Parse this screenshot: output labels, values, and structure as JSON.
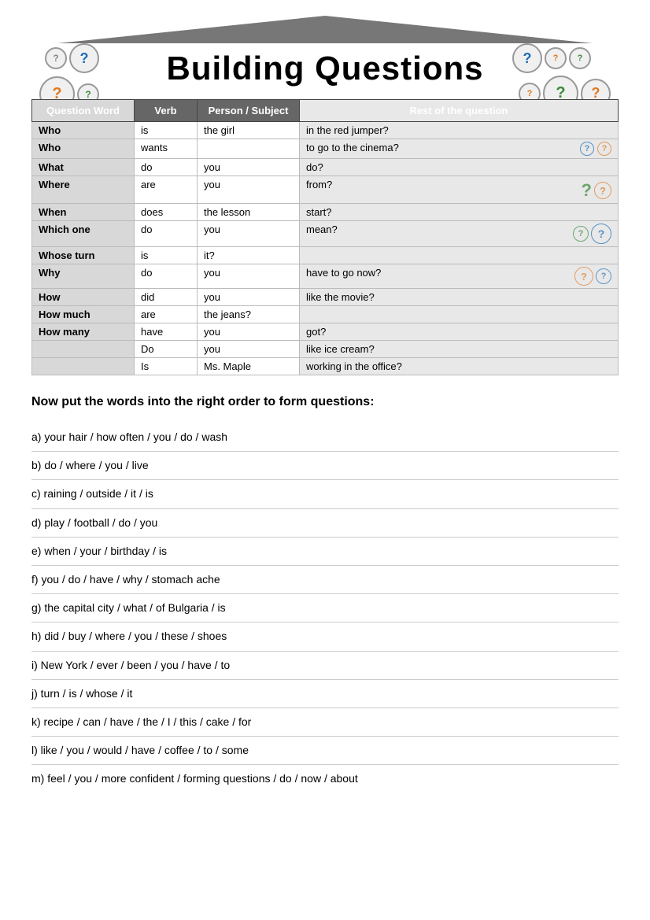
{
  "page": {
    "title": "Building Questions",
    "subtitle_instruction": "Now put the words into the right order to form questions:",
    "table": {
      "headers": [
        "Question Word",
        "Verb",
        "Person / Subject",
        "Rest of the question"
      ],
      "rows": [
        [
          "Who",
          "is",
          "the girl",
          "in the red jumper?"
        ],
        [
          "Who",
          "wants",
          "",
          "to go to the cinema?"
        ],
        [
          "What",
          "do",
          "you",
          "do?"
        ],
        [
          "Where",
          "are",
          "you",
          "from?"
        ],
        [
          "When",
          "does",
          "the lesson",
          "start?"
        ],
        [
          "Which one",
          "do",
          "you",
          "mean?"
        ],
        [
          "Whose turn",
          "is",
          "it?",
          ""
        ],
        [
          "Why",
          "do",
          "you",
          "have to go now?"
        ],
        [
          "How",
          "did",
          "you",
          "like the movie?"
        ],
        [
          "How much",
          "are",
          "the jeans?",
          ""
        ],
        [
          "How many",
          "have",
          "you",
          "got?"
        ],
        [
          "",
          "Do",
          "you",
          "like ice cream?"
        ],
        [
          "",
          "Is",
          "Ms. Maple",
          "working in the office?"
        ]
      ]
    },
    "exercises": [
      {
        "id": "a",
        "text": "a) your hair / how often / you / do / wash"
      },
      {
        "id": "b",
        "text": "b) do / where / you / live"
      },
      {
        "id": "c",
        "text": "c) raining / outside / it / is"
      },
      {
        "id": "d",
        "text": "d) play / football / do / you"
      },
      {
        "id": "e",
        "text": "e) when / your / birthday / is"
      },
      {
        "id": "f",
        "text": "f) you / do / have / why / stomach ache"
      },
      {
        "id": "g",
        "text": "g) the capital city / what / of Bulgaria / is"
      },
      {
        "id": "h",
        "text": "h) did / buy / where / you / these / shoes"
      },
      {
        "id": "i",
        "text": "i) New York / ever / been / you / have / to"
      },
      {
        "id": "j",
        "text": "j) turn / is / whose / it"
      },
      {
        "id": "k",
        "text": "k) recipe / can / have / the / I / this / cake / for"
      },
      {
        "id": "l",
        "text": "l) like / you / would / have / coffee / to / some"
      },
      {
        "id": "m",
        "text": "m) feel / you / more confident / forming questions / do / now / about"
      }
    ]
  }
}
